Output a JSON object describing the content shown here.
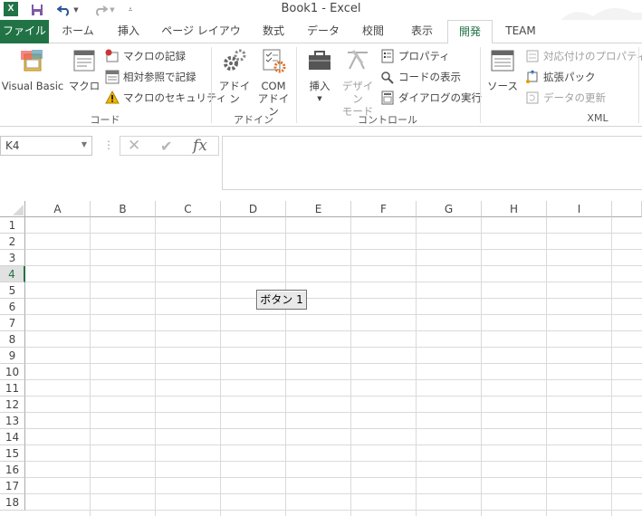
{
  "window": {
    "title": "Book1 - Excel"
  },
  "qat": {
    "save_icon": "save-icon",
    "undo_icon": "undo-icon",
    "redo_icon": "redo-icon",
    "customize_icon": "customize-qat-icon"
  },
  "tabs": [
    "ファイル",
    "ホーム",
    "挿入",
    "ページ レイアウト",
    "数式",
    "データ",
    "校閲",
    "表示",
    "開発",
    "TEAM"
  ],
  "active_tab": "開発",
  "ribbon": {
    "code": {
      "label": "コード",
      "visual_basic": "Visual Basic",
      "macros": "マクロ",
      "record_macro": "マクロの記録",
      "relative_refs": "相対参照で記録",
      "macro_security": "マクロのセキュリティ"
    },
    "addins": {
      "label": "アドイン",
      "addins": "アドイン",
      "com_addins_1": "COM",
      "com_addins_2": "アドイン"
    },
    "controls": {
      "label": "コントロール",
      "insert": "挿入",
      "design_mode_1": "デザイン",
      "design_mode_2": "モード",
      "properties": "プロパティ",
      "view_code": "コードの表示",
      "run_dialog": "ダイアログの実行"
    },
    "xml": {
      "label": "XML",
      "source": "ソース",
      "map_properties": "対応付けのプロパティ",
      "expansion_packs": "拡張パック",
      "refresh_data": "データの更新"
    }
  },
  "formula_bar": {
    "name_box": "K4",
    "cancel": "✕",
    "enter": "✔",
    "fx": "fx",
    "separator": "⋮"
  },
  "grid": {
    "columns": [
      "A",
      "B",
      "C",
      "D",
      "E",
      "F",
      "G",
      "H",
      "I"
    ],
    "rows": [
      "1",
      "2",
      "3",
      "4",
      "5",
      "6",
      "7",
      "8",
      "9",
      "10",
      "11",
      "12",
      "13",
      "14",
      "15",
      "16",
      "17",
      "18"
    ],
    "active_row": "4"
  },
  "form_button": {
    "label": "ボタン 1"
  },
  "colors": {
    "accent": "#217346"
  }
}
